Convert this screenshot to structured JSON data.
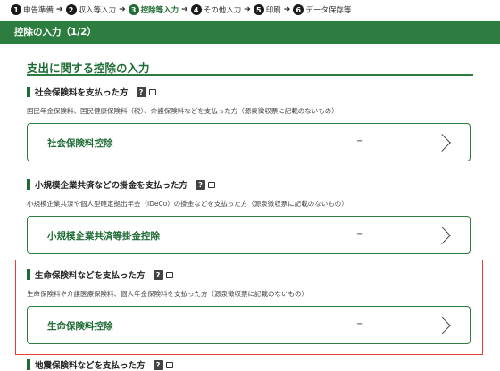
{
  "steps": [
    {
      "num": "1",
      "label": "申告準備",
      "active": false
    },
    {
      "num": "2",
      "label": "収入等入力",
      "active": false
    },
    {
      "num": "3",
      "label": "控除等入力",
      "active": true
    },
    {
      "num": "4",
      "label": "その他入力",
      "active": false
    },
    {
      "num": "5",
      "label": "印刷",
      "active": false
    },
    {
      "num": "6",
      "label": "データ保存等",
      "active": false
    }
  ],
  "page_title": "控除の入力（1/2）",
  "section_title": "支出に関する控除の入力",
  "help_icon_label": "?",
  "blocks": [
    {
      "heading": "社会保険料を支払った方",
      "description": "国民年金保険料、国民健康保険料（税）、介護保険料などを支払った方（源泉徴収票に記載のないもの）",
      "card_label": "社会保険料控除",
      "card_value": "−"
    },
    {
      "heading": "小規模企業共済などの掛金を支払った方",
      "description": "小規模企業共済や個人型確定拠出年金（iDeCo）の掛金などを支払った方（源泉徴収票に記載のないもの）",
      "card_label": "小規模企業共済等掛金控除",
      "card_value": "−"
    },
    {
      "heading": "生命保険料などを支払った方",
      "description": "生命保険料や介護医療保険料、個人年金保険料を支払った方（源泉徴収票に記載のないもの）",
      "card_label": "生命保険料控除",
      "card_value": "−"
    },
    {
      "heading": "地震保険料などを支払った方"
    }
  ],
  "colors": {
    "brand_green": "#2c7d3f",
    "highlight_red": "#e53c3c"
  }
}
